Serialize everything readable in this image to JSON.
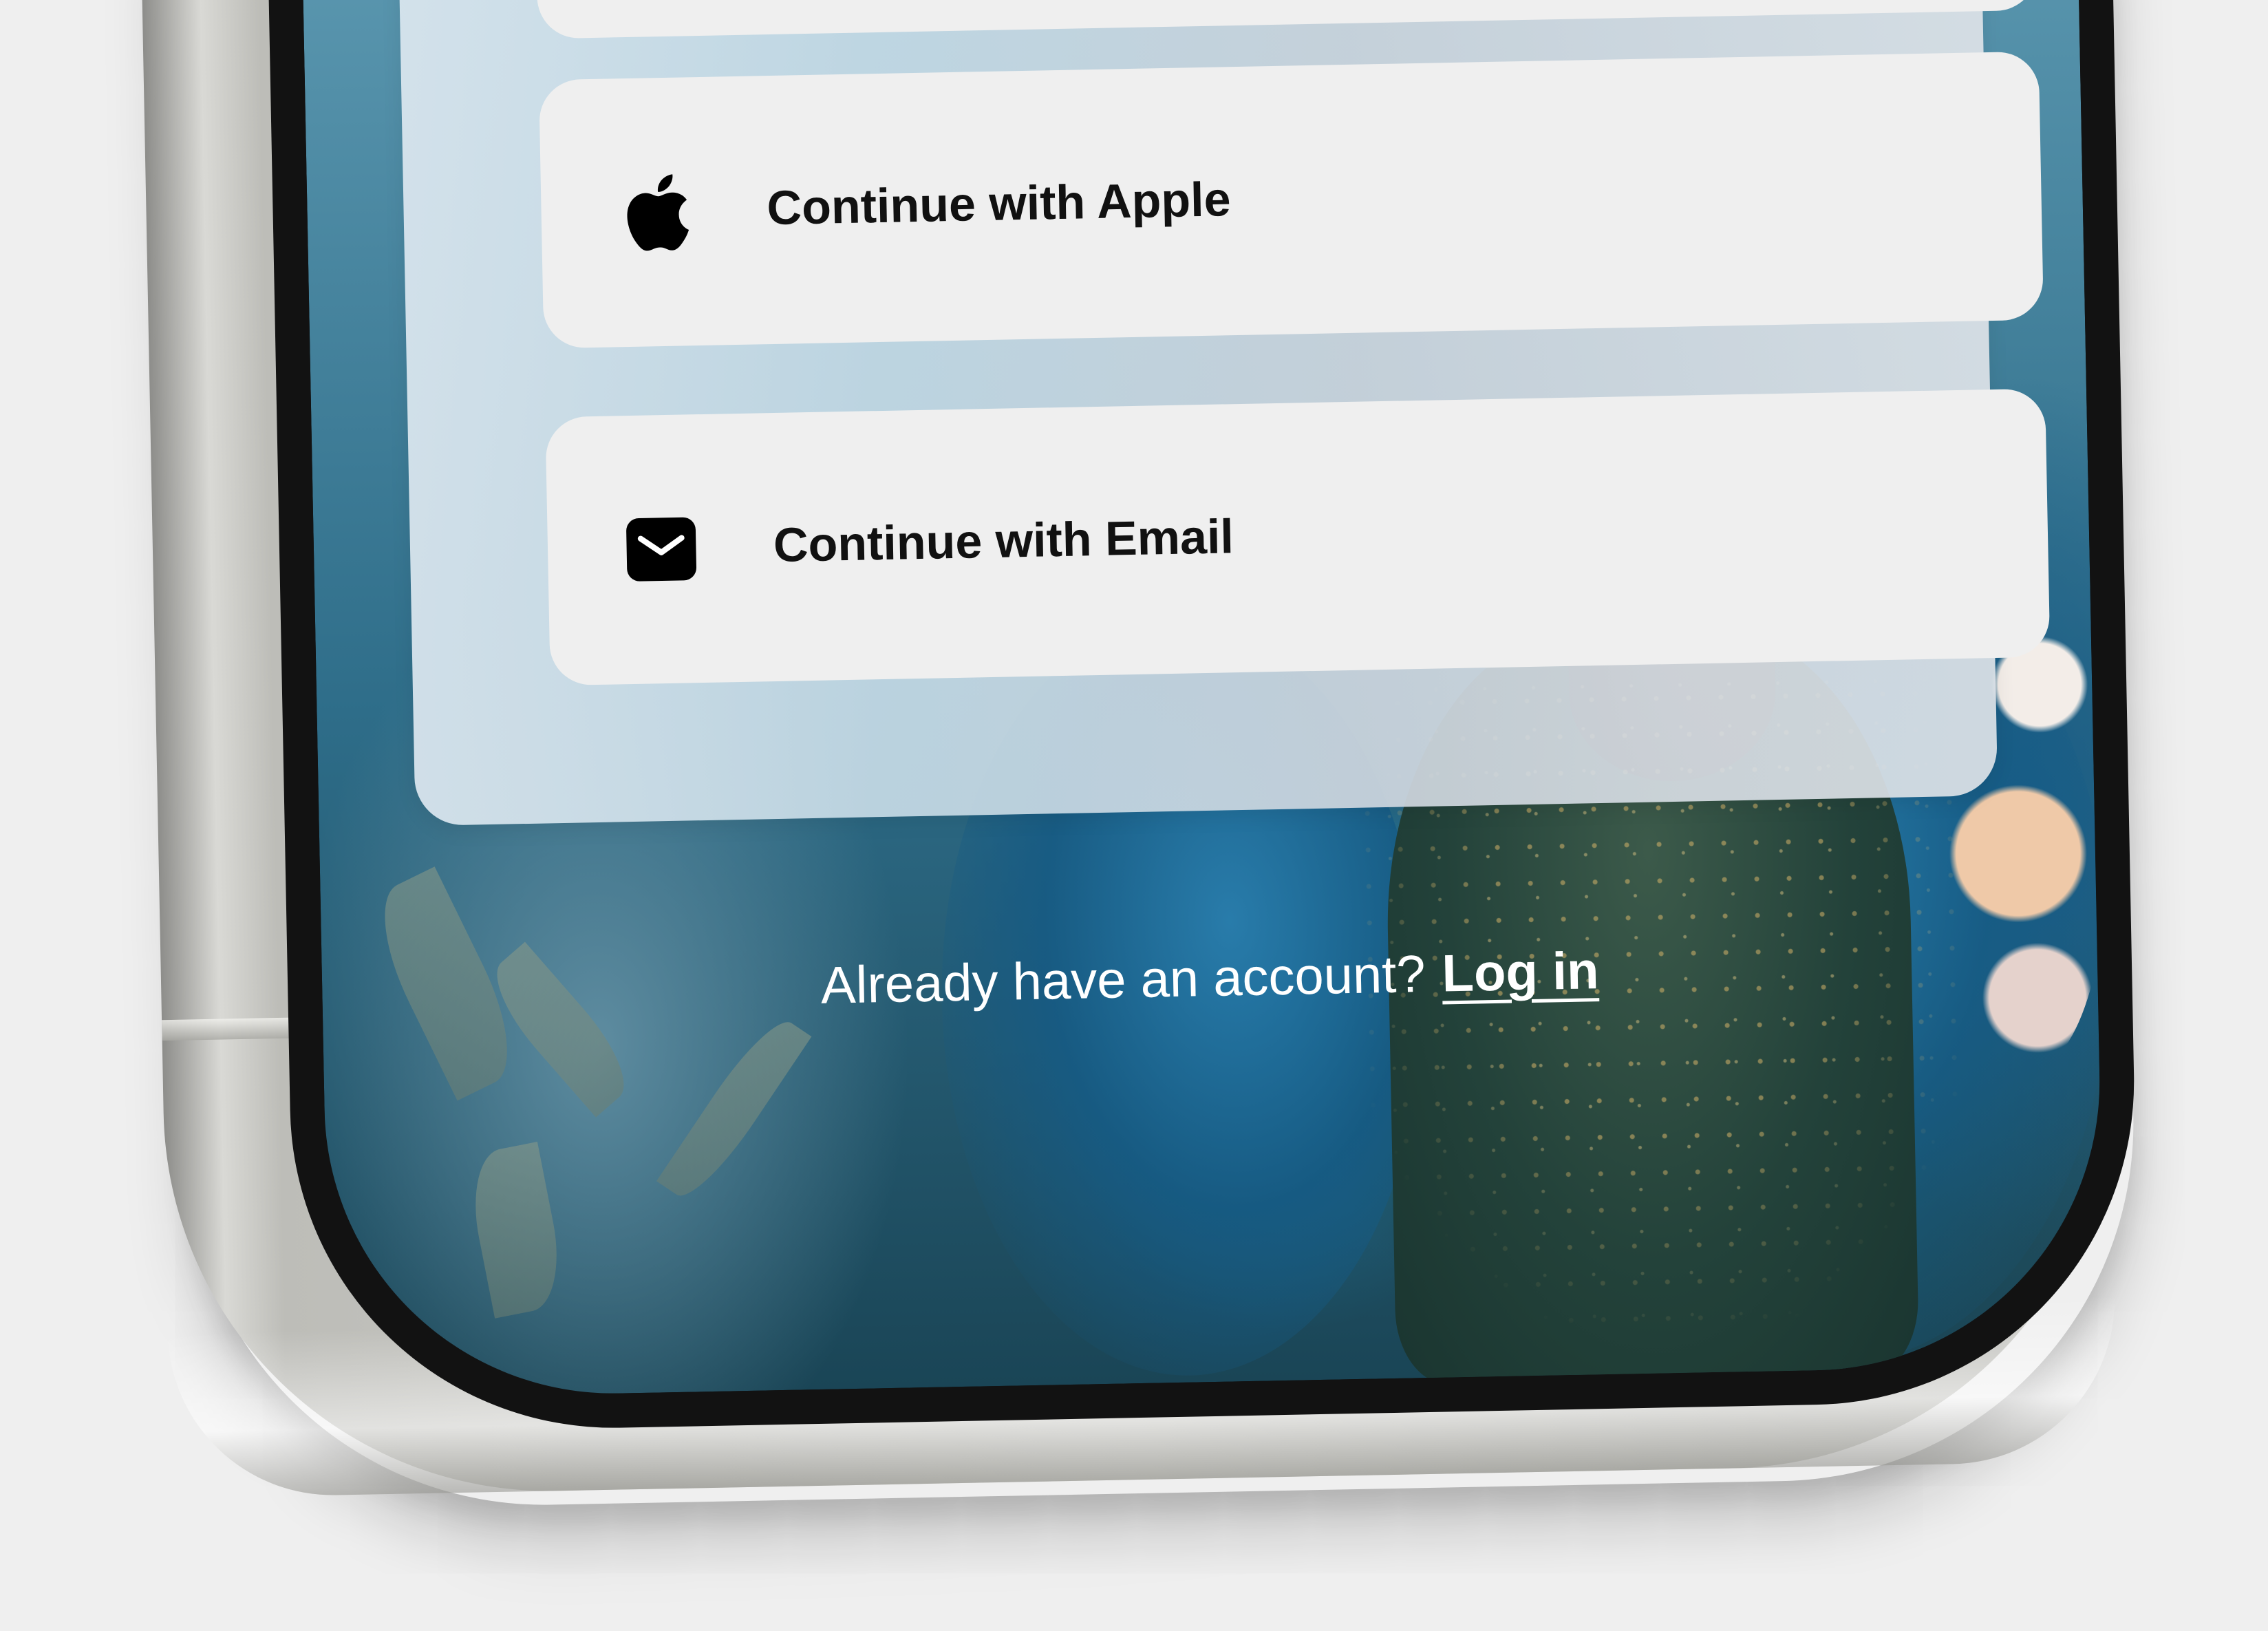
{
  "auth_options": {
    "apple": {
      "label": "Continue with Apple",
      "icon": "apple-logo-icon"
    },
    "email": {
      "label": "Continue with Email",
      "icon": "envelope-icon"
    }
  },
  "footer": {
    "prompt": "Already have an account?",
    "login_link": "Log in"
  },
  "colors": {
    "button_background": "#efefef",
    "button_text": "#111111",
    "footer_text": "#ffffff",
    "device_frame": "#cfcfca",
    "page_background": "#efefef"
  }
}
